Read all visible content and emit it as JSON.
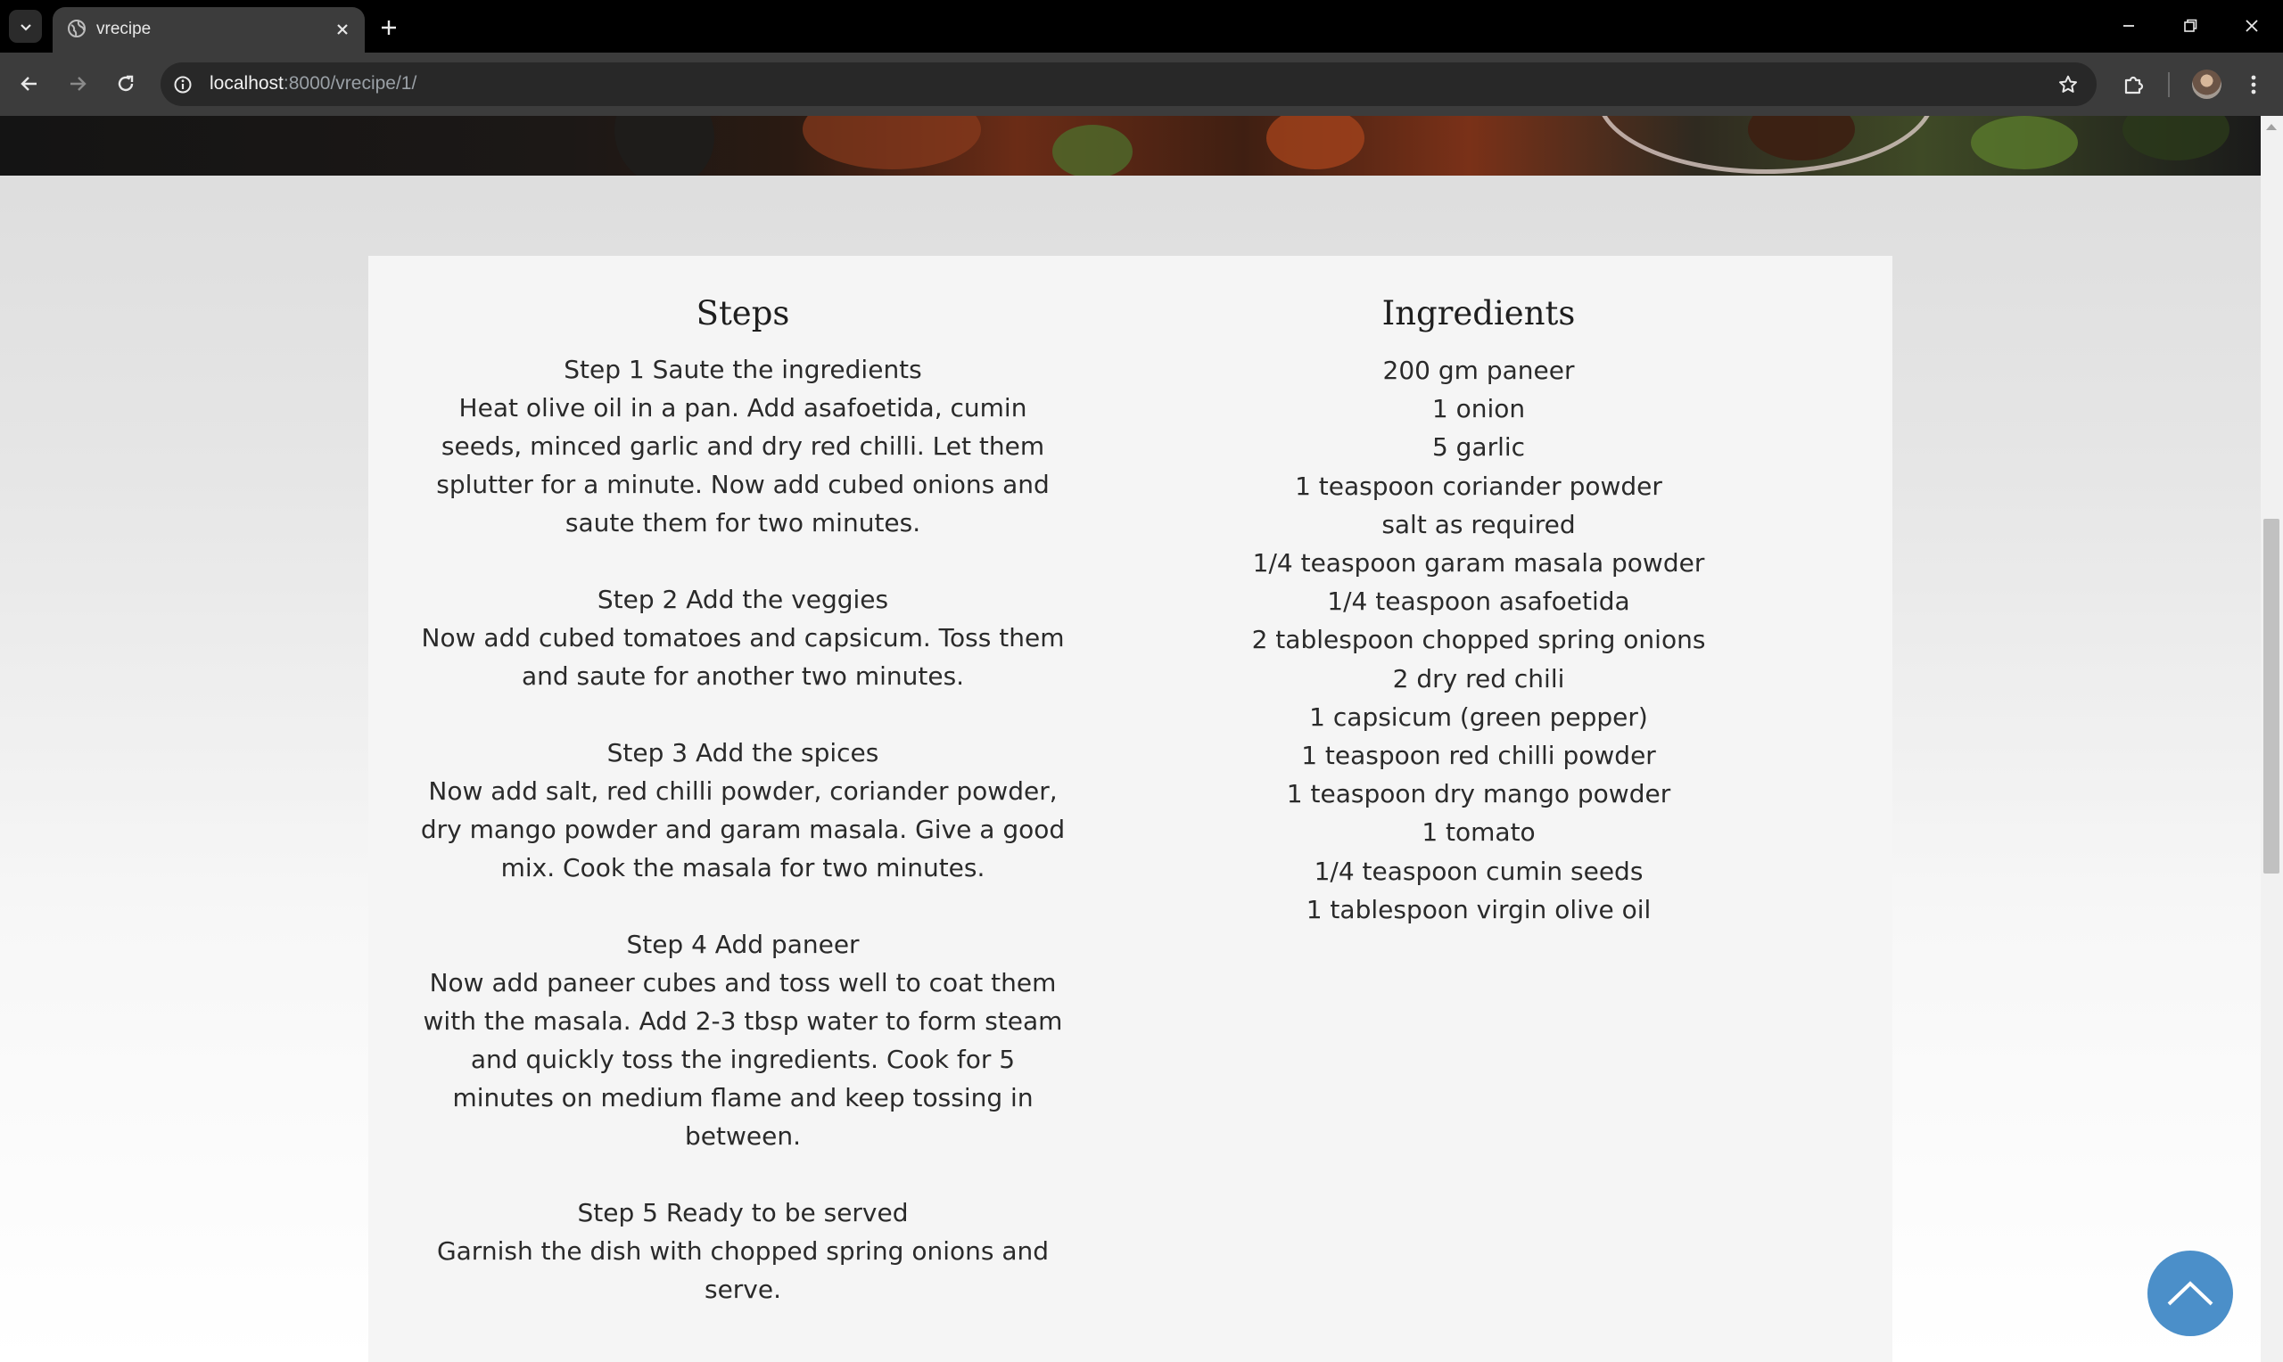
{
  "browser": {
    "tab_title": "vrecipe",
    "url_host": "localhost",
    "url_path": ":8000/vrecipe/1/"
  },
  "recipe": {
    "steps_heading": "Steps",
    "steps": [
      "Step 1 Saute the ingredients",
      "Heat olive oil in a pan. Add asafoetida, cumin seeds, minced garlic and dry red chilli. Let them splutter for a minute. Now add cubed onions and saute them for two minutes.",
      "Step 2 Add the veggies",
      "Now add cubed tomatoes and capsicum. Toss them and saute for another two minutes.",
      "Step 3 Add the spices",
      "Now add salt, red chilli powder, coriander powder, dry mango powder and garam masala. Give a good mix. Cook the masala for two minutes.",
      "Step 4 Add paneer",
      "Now add paneer cubes and toss well to coat them with the masala. Add 2-3 tbsp water to form steam and quickly toss the ingredients. Cook for 5 minutes on medium flame and keep tossing in between.",
      "Step 5 Ready to be served",
      "Garnish the dish with chopped spring onions and serve."
    ],
    "ingredients_heading": "Ingredients",
    "ingredients": [
      "200 gm paneer",
      "1 onion",
      "5 garlic",
      "1 teaspoon coriander powder",
      "salt as required",
      "1/4 teaspoon garam masala powder",
      "1/4 teaspoon asafoetida",
      "2 tablespoon chopped spring onions",
      "2 dry red chili",
      "1 capsicum (green pepper)",
      "1 teaspoon red chilli powder",
      "1 teaspoon dry mango powder",
      "1 tomato",
      "1/4 teaspoon cumin seeds",
      "1 tablespoon virgin olive oil"
    ]
  },
  "colors": {
    "back_to_top": "#4b8fc9",
    "chrome_bg": "#3c3c3c"
  }
}
